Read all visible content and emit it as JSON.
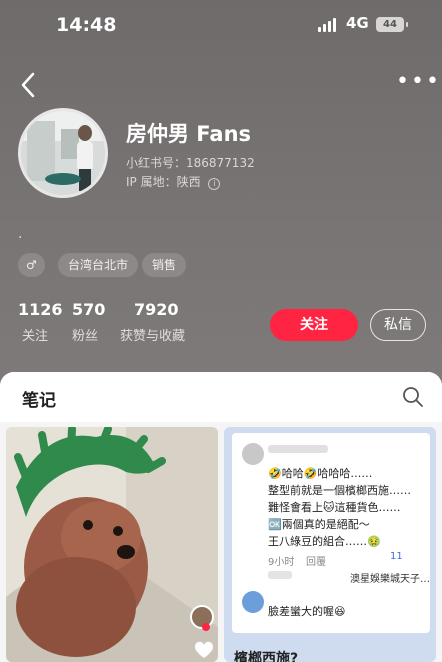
{
  "status_bar": {
    "time": "14:48",
    "network": "4G",
    "battery": "44"
  },
  "profile": {
    "name": "房仲男 Fans",
    "red_id": "小红书号：186877132",
    "ip_location": "IP 属地：陕西",
    "bio": ".",
    "tags": [
      "台湾台北市",
      "销售"
    ],
    "stats": [
      {
        "value": "1126",
        "label": "关注"
      },
      {
        "value": "570",
        "label": "粉丝"
      },
      {
        "value": "7920",
        "label": "获赞与收藏"
      }
    ],
    "follow_label": "关注",
    "message_label": "私信"
  },
  "notes_section": {
    "tab_label": "笔记"
  },
  "notes": [
    {
      "title": ""
    },
    {
      "title": "檳榔西施?",
      "comment_lines": [
        "🤣哈哈🤣哈哈哈……",
        "整型前就是一個檳榔西施……",
        "難怪會看上🐱這種貨色……",
        "🆗兩個真的是絕配～",
        "王八綠豆的組合……🤢"
      ],
      "comment_time": "9小时",
      "reply_label": "回覆",
      "likes": "11",
      "reply_author": "澳星娛樂城天子…",
      "reply_text": "臉差蠻大的喔😆"
    }
  ],
  "colors": {
    "accent": "#ff2442",
    "header_bg": "#7a7474"
  }
}
